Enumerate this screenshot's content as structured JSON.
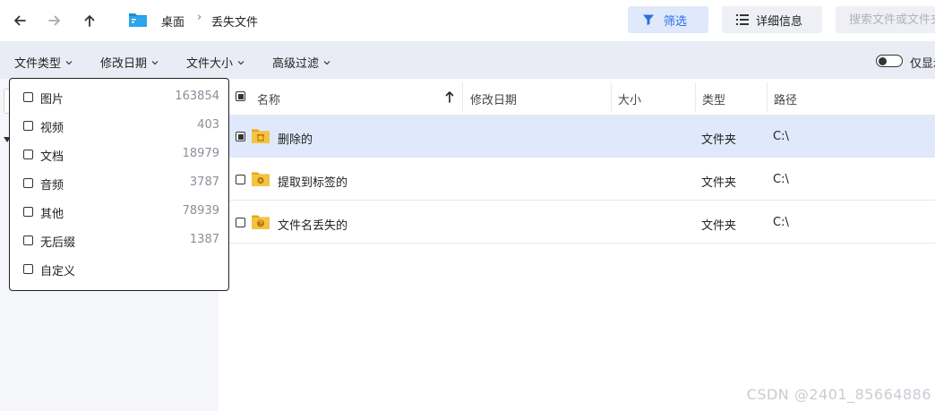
{
  "colors": {
    "accent": "#2f6fe0",
    "selected_row": "#dfe9fb",
    "filterbar_bg": "#e9ecf4",
    "folder": "#f5c343"
  },
  "toolbar": {
    "breadcrumb": [
      "桌面",
      "丢失文件"
    ],
    "breadcrumb_sep": "›",
    "filter_label": "筛选",
    "detail_label": "详细信息",
    "search_placeholder": "搜索文件或文件夹"
  },
  "filterbar": {
    "items": [
      "文件类型",
      "修改日期",
      "文件大小",
      "高级过滤"
    ],
    "toggle_label": "仅显示"
  },
  "table": {
    "headers": {
      "name": "名称",
      "modified": "修改日期",
      "size": "大小",
      "type": "类型",
      "path": "路径"
    },
    "rows": [
      {
        "name": "删除的",
        "type": "文件夹",
        "path": "C:\\",
        "icon": "deleted-folder-icon"
      },
      {
        "name": "提取到标签的",
        "type": "文件夹",
        "path": "C:\\",
        "icon": "tagged-folder-icon"
      },
      {
        "name": "文件名丢失的",
        "type": "文件夹",
        "path": "C:\\",
        "icon": "unknown-folder-icon"
      }
    ]
  },
  "dropdown": {
    "items": [
      {
        "label": "图片",
        "count": "163854"
      },
      {
        "label": "视频",
        "count": "403"
      },
      {
        "label": "文档",
        "count": "18979"
      },
      {
        "label": "音频",
        "count": "3787"
      },
      {
        "label": "其他",
        "count": "78939"
      },
      {
        "label": "无后缀",
        "count": "1387"
      },
      {
        "label": "自定义",
        "count": ""
      }
    ]
  },
  "watermark": "CSDN @2401_85664886"
}
